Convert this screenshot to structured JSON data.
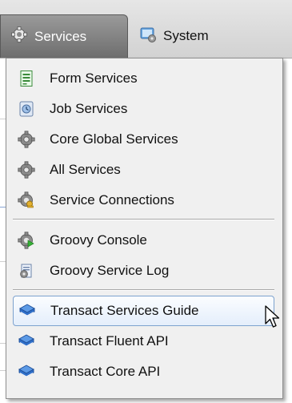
{
  "toolbar": {
    "tabs": [
      {
        "label": "Services",
        "icon": "gear-icon",
        "active": true
      },
      {
        "label": "System",
        "icon": "monitor-icon",
        "active": false
      }
    ]
  },
  "menu": {
    "groups": [
      [
        {
          "label": "Form Services",
          "icon": "form-document-icon"
        },
        {
          "label": "Job Services",
          "icon": "job-clock-icon"
        },
        {
          "label": "Core Global Services",
          "icon": "gear-icon"
        },
        {
          "label": "All Services",
          "icon": "gear-icon"
        },
        {
          "label": "Service Connections",
          "icon": "gear-key-icon"
        }
      ],
      [
        {
          "label": "Groovy Console",
          "icon": "groovy-gear-icon"
        },
        {
          "label": "Groovy Service Log",
          "icon": "groovy-log-icon"
        }
      ],
      [
        {
          "label": "Transact Services Guide",
          "icon": "book-icon",
          "highlighted": true
        },
        {
          "label": "Transact Fluent API",
          "icon": "book-icon"
        },
        {
          "label": "Transact Core API",
          "icon": "book-icon"
        }
      ]
    ]
  },
  "colors": {
    "active_tab": "#7c7c7c",
    "menu_background": "#f0f0f0",
    "highlight_border": "#7da2ce",
    "book_blue": "#2f6fc9"
  }
}
